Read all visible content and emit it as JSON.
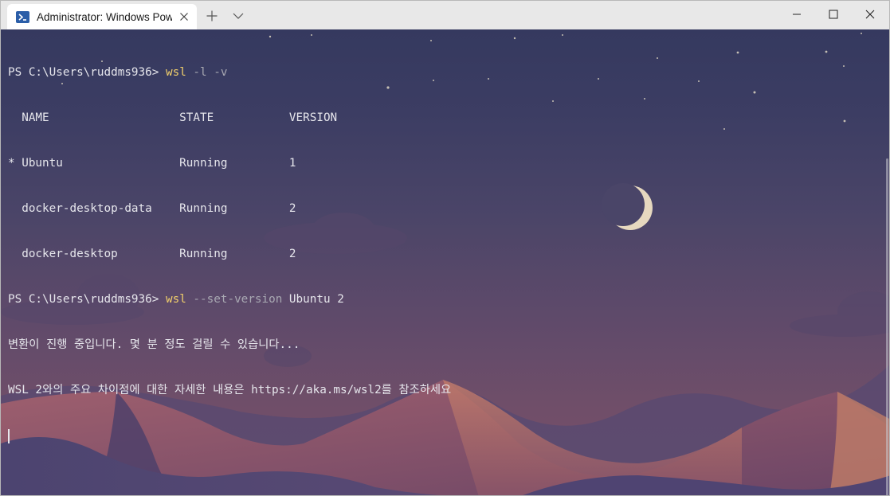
{
  "window": {
    "tab_title": "Administrator: Windows Power",
    "tab_icon": "powershell-icon",
    "new_tab_icon": "plus-icon",
    "dropdown_icon": "chevron-down-icon",
    "minimize_icon": "minimize-icon",
    "maximize_icon": "maximize-icon",
    "close_icon": "close-icon"
  },
  "terminal": {
    "line1": {
      "prompt": "PS C:\\Users\\ruddms936> ",
      "command": "wsl",
      "args": " -l -v"
    },
    "line2": "  NAME                   STATE           VERSION",
    "line3": "* Ubuntu                 Running         1",
    "line4": "  docker-desktop-data    Running         2",
    "line5": "  docker-desktop         Running         2",
    "line6": {
      "prompt": "PS C:\\Users\\ruddms936> ",
      "command": "wsl",
      "param": " --set-version",
      "args": " Ubuntu 2"
    },
    "line7": "변환이 진행 중입니다. 몇 분 정도 걸릴 수 있습니다...",
    "line8": "WSL 2와의 주요 차이점에 대한 자세한 내용은 https://aka.ms/wsl2를 참조하세요"
  },
  "colors": {
    "command": "#f2d06b",
    "parameter": "#a8a8b2",
    "text": "#e6e6ec"
  }
}
